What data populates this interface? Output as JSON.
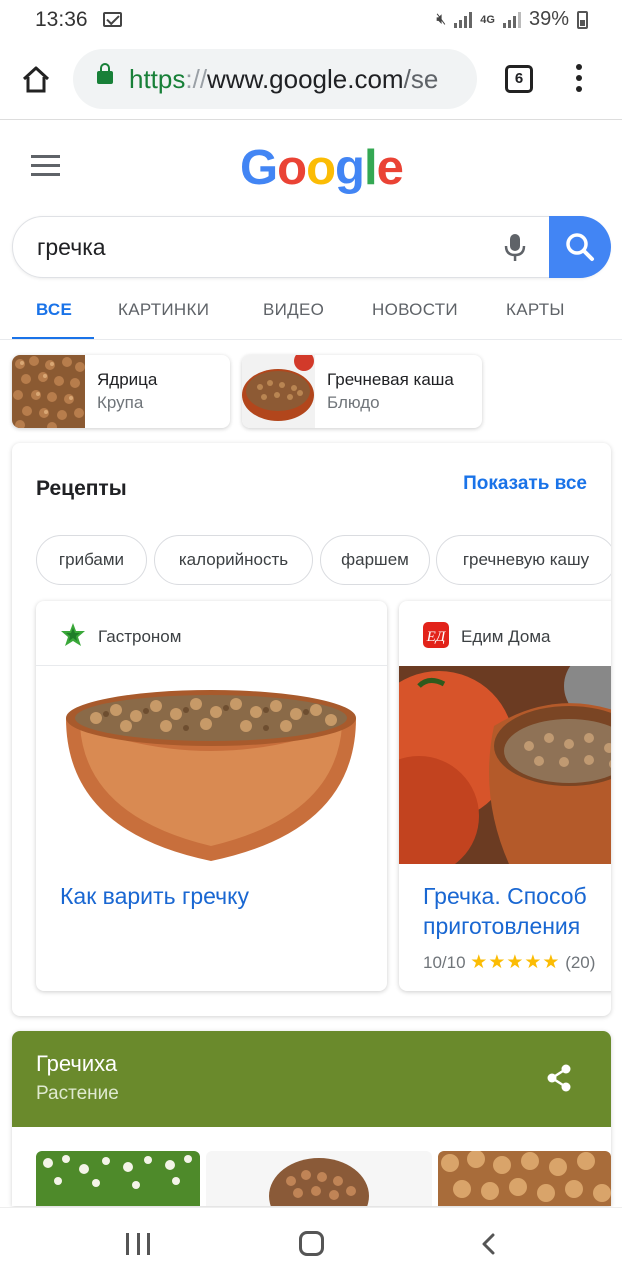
{
  "status_bar": {
    "time": "13:36",
    "network": "4G",
    "battery": "39%"
  },
  "browser": {
    "url_scheme": "https",
    "url_sep": "://",
    "url_host": "www.google.com",
    "url_path": "/se",
    "tab_count": "6"
  },
  "logo": [
    "G",
    "o",
    "o",
    "g",
    "l",
    "e"
  ],
  "search": {
    "query": "гречка"
  },
  "tabs": [
    {
      "label": "ВСЕ"
    },
    {
      "label": "КАРТИНКИ"
    },
    {
      "label": "ВИДЕО"
    },
    {
      "label": "НОВОСТИ"
    },
    {
      "label": "КАРТЫ"
    }
  ],
  "entity_chips": [
    {
      "title": "Ядрица",
      "subtitle": "Крупа"
    },
    {
      "title": "Гречневая каша",
      "subtitle": "Блюдо"
    }
  ],
  "recipes": {
    "title": "Рецепты",
    "show_all": "Показать все",
    "filters": [
      "грибами",
      "калорийность",
      "фаршем",
      "гречневую кашу"
    ],
    "cards": [
      {
        "source": "Гастроном",
        "title": "Как варить гречку"
      },
      {
        "source": "Едим Дома",
        "title": "Гречка. Способ приготовления",
        "rating": "10/10",
        "stars": "★★★★★",
        "reviews": "(20)"
      }
    ]
  },
  "knowledge_panel": {
    "title": "Гречиха",
    "subtitle": "Растение",
    "accent_color": "#6a8a2c"
  }
}
